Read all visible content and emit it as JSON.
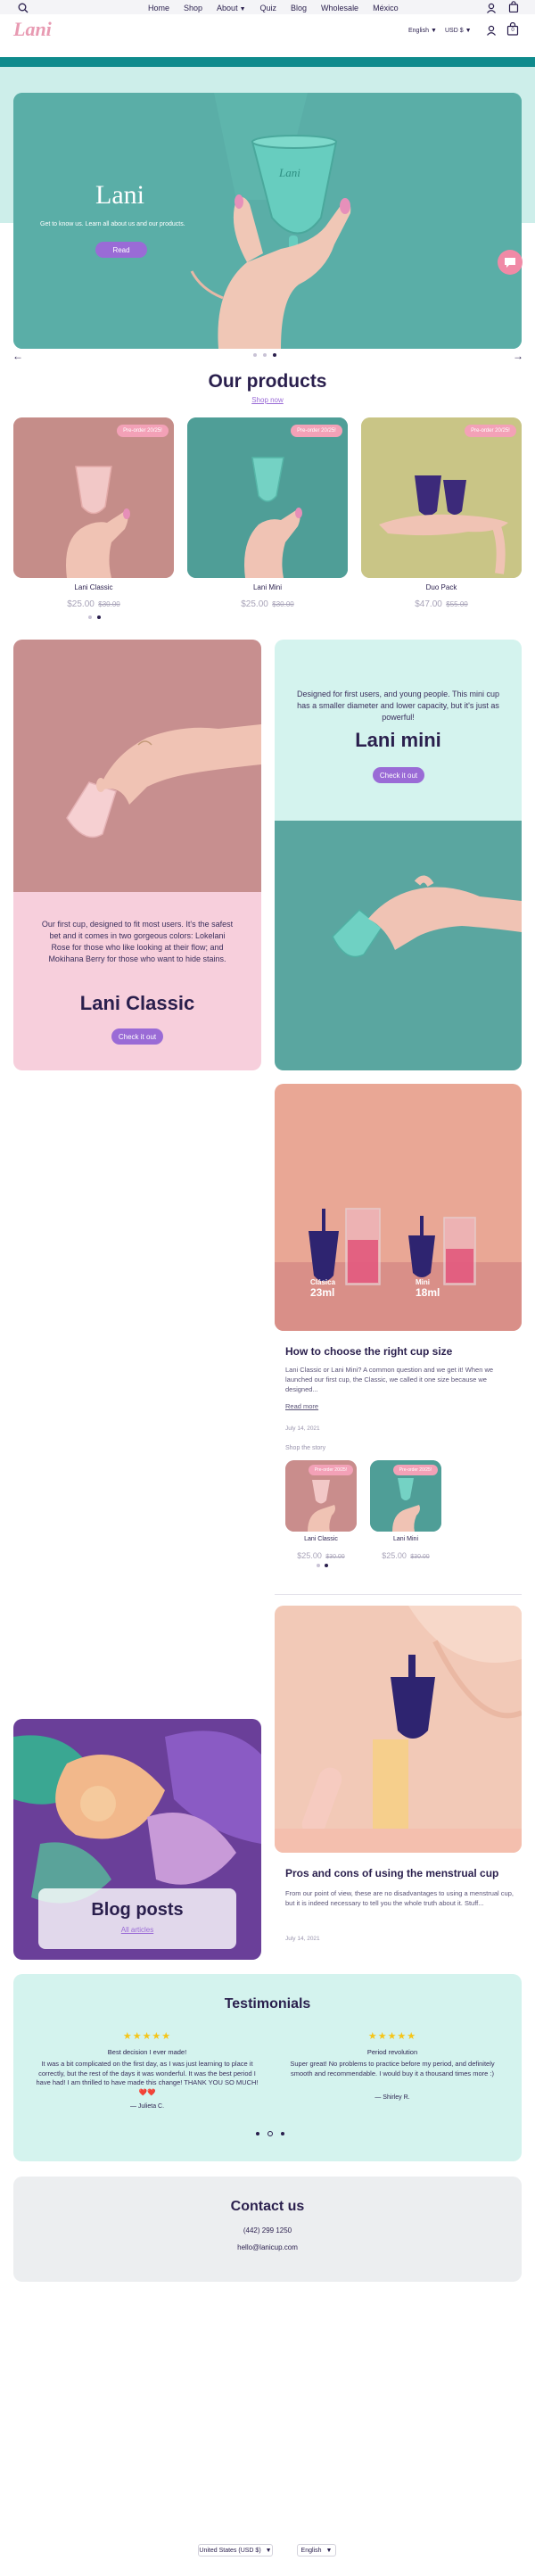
{
  "header": {
    "nav": [
      "Home",
      "Shop",
      "About",
      "Quiz",
      "Blog",
      "Wholesale",
      "México"
    ],
    "logo": "Lani",
    "language": "English",
    "currency": "USD $",
    "cart_count": "0",
    "accent": "#0f8b8d"
  },
  "hero": {
    "title": "Lani",
    "subtitle": "Get to know us. Learn all about us and our products.",
    "button": "Read",
    "cup_text": "Lani"
  },
  "products": {
    "title": "Our products",
    "link": "Shop now",
    "items": [
      {
        "badge": "Pre-order 20/25!",
        "name": "Lani Classic",
        "price": "$25.00",
        "compare": "$30.00"
      },
      {
        "badge": "Pre-order 20/25!",
        "name": "Lani Mini",
        "price": "$25.00",
        "compare": "$30.00"
      },
      {
        "badge": "Pre-order 20/25!",
        "name": "Duo Pack",
        "price": "$47.00",
        "compare": "$55.00"
      }
    ]
  },
  "classic": {
    "text": "Our first cup, designed to fit most users. It's the safest bet and it comes in two gorgeous colors: Lokelani Rose for those who like looking at their flow; and Mokihana Berry for those who want to hide stains.",
    "title": "Lani Classic",
    "button": "Check it out"
  },
  "mini": {
    "text": "Designed for first users, and young people. This mini cup has a smaller diameter and lower capacity, but it's just as powerful!",
    "title": "Lani mini",
    "button": "Check it out"
  },
  "blog1": {
    "label_left": "Clásica",
    "value_left": "23ml",
    "label_right": "Mini",
    "value_right": "18ml",
    "title": "How to choose the right cup size",
    "excerpt": "Lani Classic or Lani Mini? A common question and we get it! When we launched our first cup, the Classic, we called it one size because we designed...",
    "read_more": "Read more",
    "date": "July 14, 2021",
    "shop_label": "Shop the story",
    "items": [
      {
        "badge": "Pre-order 20/25!",
        "name": "Lani Classic",
        "price": "$25.00",
        "compare": "$30.00"
      },
      {
        "badge": "Pre-order 20/25!",
        "name": "Lani Mini",
        "price": "$25.00",
        "compare": "$30.00"
      }
    ]
  },
  "blog_posts": {
    "title": "Blog posts",
    "link": "All articles"
  },
  "blog2": {
    "title": "Pros and cons of using the menstrual cup",
    "excerpt": "From our point of view, these are no disadvantages to using a menstrual cup, but it is indeed necessary to tell you the whole truth about it. Stuff...",
    "date": "July 14, 2021"
  },
  "testimonials": {
    "title": "Testimonials",
    "items": [
      {
        "stars": "★★★★★",
        "title": "Best decision I ever made!",
        "body": "It was a bit complicated on the first day, as I was just learning to place it correctly, but the rest of the days it was wonderful. It was the best period I have had! I am thrilled to have made this change! THANK YOU SO MUCH! ❤️❤️",
        "author": "— Julieta C."
      },
      {
        "stars": "★★★★★",
        "title": "Period revolution",
        "body": "Super great! No problems to practice before my period, and definitely smooth and recommendable. I would buy it a thousand times more :)",
        "author": "— Shirley R."
      }
    ]
  },
  "contact": {
    "title": "Contact us",
    "phone": "(442) 299 1250",
    "email": "hello@lanicup.com"
  },
  "footer": {
    "country": "United States (USD $)",
    "language": "English"
  }
}
